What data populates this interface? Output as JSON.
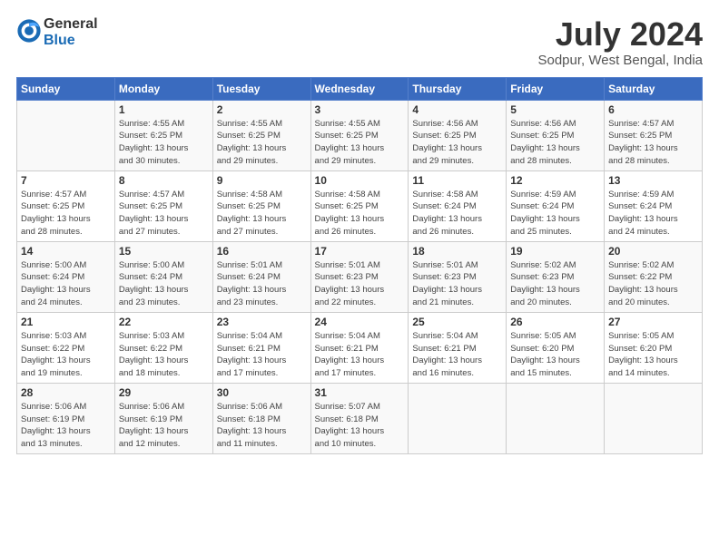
{
  "header": {
    "logo_line1": "General",
    "logo_line2": "Blue",
    "month": "July 2024",
    "location": "Sodpur, West Bengal, India"
  },
  "days_of_week": [
    "Sunday",
    "Monday",
    "Tuesday",
    "Wednesday",
    "Thursday",
    "Friday",
    "Saturday"
  ],
  "weeks": [
    [
      {
        "day": "",
        "info": ""
      },
      {
        "day": "1",
        "info": "Sunrise: 4:55 AM\nSunset: 6:25 PM\nDaylight: 13 hours\nand 30 minutes."
      },
      {
        "day": "2",
        "info": "Sunrise: 4:55 AM\nSunset: 6:25 PM\nDaylight: 13 hours\nand 29 minutes."
      },
      {
        "day": "3",
        "info": "Sunrise: 4:55 AM\nSunset: 6:25 PM\nDaylight: 13 hours\nand 29 minutes."
      },
      {
        "day": "4",
        "info": "Sunrise: 4:56 AM\nSunset: 6:25 PM\nDaylight: 13 hours\nand 29 minutes."
      },
      {
        "day": "5",
        "info": "Sunrise: 4:56 AM\nSunset: 6:25 PM\nDaylight: 13 hours\nand 28 minutes."
      },
      {
        "day": "6",
        "info": "Sunrise: 4:57 AM\nSunset: 6:25 PM\nDaylight: 13 hours\nand 28 minutes."
      }
    ],
    [
      {
        "day": "7",
        "info": "Sunrise: 4:57 AM\nSunset: 6:25 PM\nDaylight: 13 hours\nand 28 minutes."
      },
      {
        "day": "8",
        "info": "Sunrise: 4:57 AM\nSunset: 6:25 PM\nDaylight: 13 hours\nand 27 minutes."
      },
      {
        "day": "9",
        "info": "Sunrise: 4:58 AM\nSunset: 6:25 PM\nDaylight: 13 hours\nand 27 minutes."
      },
      {
        "day": "10",
        "info": "Sunrise: 4:58 AM\nSunset: 6:25 PM\nDaylight: 13 hours\nand 26 minutes."
      },
      {
        "day": "11",
        "info": "Sunrise: 4:58 AM\nSunset: 6:24 PM\nDaylight: 13 hours\nand 26 minutes."
      },
      {
        "day": "12",
        "info": "Sunrise: 4:59 AM\nSunset: 6:24 PM\nDaylight: 13 hours\nand 25 minutes."
      },
      {
        "day": "13",
        "info": "Sunrise: 4:59 AM\nSunset: 6:24 PM\nDaylight: 13 hours\nand 24 minutes."
      }
    ],
    [
      {
        "day": "14",
        "info": "Sunrise: 5:00 AM\nSunset: 6:24 PM\nDaylight: 13 hours\nand 24 minutes."
      },
      {
        "day": "15",
        "info": "Sunrise: 5:00 AM\nSunset: 6:24 PM\nDaylight: 13 hours\nand 23 minutes."
      },
      {
        "day": "16",
        "info": "Sunrise: 5:01 AM\nSunset: 6:24 PM\nDaylight: 13 hours\nand 23 minutes."
      },
      {
        "day": "17",
        "info": "Sunrise: 5:01 AM\nSunset: 6:23 PM\nDaylight: 13 hours\nand 22 minutes."
      },
      {
        "day": "18",
        "info": "Sunrise: 5:01 AM\nSunset: 6:23 PM\nDaylight: 13 hours\nand 21 minutes."
      },
      {
        "day": "19",
        "info": "Sunrise: 5:02 AM\nSunset: 6:23 PM\nDaylight: 13 hours\nand 20 minutes."
      },
      {
        "day": "20",
        "info": "Sunrise: 5:02 AM\nSunset: 6:22 PM\nDaylight: 13 hours\nand 20 minutes."
      }
    ],
    [
      {
        "day": "21",
        "info": "Sunrise: 5:03 AM\nSunset: 6:22 PM\nDaylight: 13 hours\nand 19 minutes."
      },
      {
        "day": "22",
        "info": "Sunrise: 5:03 AM\nSunset: 6:22 PM\nDaylight: 13 hours\nand 18 minutes."
      },
      {
        "day": "23",
        "info": "Sunrise: 5:04 AM\nSunset: 6:21 PM\nDaylight: 13 hours\nand 17 minutes."
      },
      {
        "day": "24",
        "info": "Sunrise: 5:04 AM\nSunset: 6:21 PM\nDaylight: 13 hours\nand 17 minutes."
      },
      {
        "day": "25",
        "info": "Sunrise: 5:04 AM\nSunset: 6:21 PM\nDaylight: 13 hours\nand 16 minutes."
      },
      {
        "day": "26",
        "info": "Sunrise: 5:05 AM\nSunset: 6:20 PM\nDaylight: 13 hours\nand 15 minutes."
      },
      {
        "day": "27",
        "info": "Sunrise: 5:05 AM\nSunset: 6:20 PM\nDaylight: 13 hours\nand 14 minutes."
      }
    ],
    [
      {
        "day": "28",
        "info": "Sunrise: 5:06 AM\nSunset: 6:19 PM\nDaylight: 13 hours\nand 13 minutes."
      },
      {
        "day": "29",
        "info": "Sunrise: 5:06 AM\nSunset: 6:19 PM\nDaylight: 13 hours\nand 12 minutes."
      },
      {
        "day": "30",
        "info": "Sunrise: 5:06 AM\nSunset: 6:18 PM\nDaylight: 13 hours\nand 11 minutes."
      },
      {
        "day": "31",
        "info": "Sunrise: 5:07 AM\nSunset: 6:18 PM\nDaylight: 13 hours\nand 10 minutes."
      },
      {
        "day": "",
        "info": ""
      },
      {
        "day": "",
        "info": ""
      },
      {
        "day": "",
        "info": ""
      }
    ]
  ]
}
